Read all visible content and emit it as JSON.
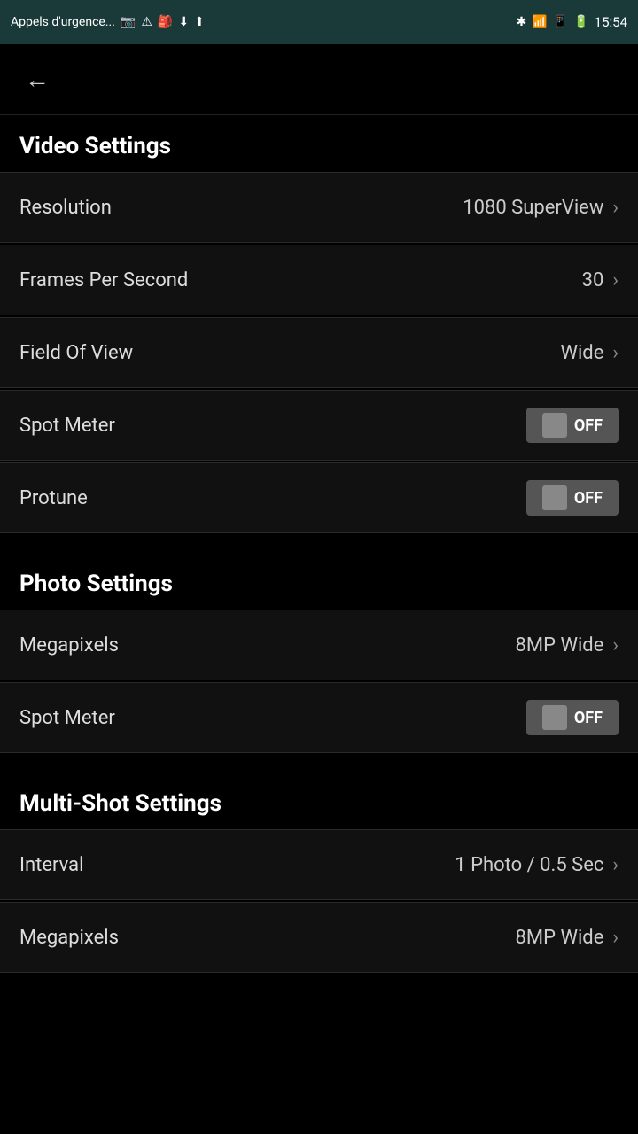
{
  "statusBar": {
    "carrier": "Appels d'urgence...",
    "time": "15:54"
  },
  "nav": {
    "backLabel": "←"
  },
  "sections": [
    {
      "id": "video-settings",
      "title": "Video Settings",
      "items": [
        {
          "id": "resolution",
          "label": "Resolution",
          "value": "1080 SuperView",
          "type": "nav"
        },
        {
          "id": "frames-per-second",
          "label": "Frames Per Second",
          "value": "30",
          "type": "nav"
        },
        {
          "id": "field-of-view",
          "label": "Field Of View",
          "value": "Wide",
          "type": "nav"
        },
        {
          "id": "spot-meter-video",
          "label": "Spot Meter",
          "value": "OFF",
          "type": "toggle"
        },
        {
          "id": "protune",
          "label": "Protune",
          "value": "OFF",
          "type": "toggle"
        }
      ]
    },
    {
      "id": "photo-settings",
      "title": "Photo Settings",
      "items": [
        {
          "id": "megapixels-photo",
          "label": "Megapixels",
          "value": "8MP Wide",
          "type": "nav"
        },
        {
          "id": "spot-meter-photo",
          "label": "Spot Meter",
          "value": "OFF",
          "type": "toggle"
        }
      ]
    },
    {
      "id": "multishot-settings",
      "title": "Multi-Shot Settings",
      "items": [
        {
          "id": "interval",
          "label": "Interval",
          "value": "1 Photo / 0.5 Sec",
          "type": "nav"
        },
        {
          "id": "megapixels-multishot",
          "label": "Megapixels",
          "value": "8MP Wide",
          "type": "nav"
        }
      ]
    }
  ]
}
